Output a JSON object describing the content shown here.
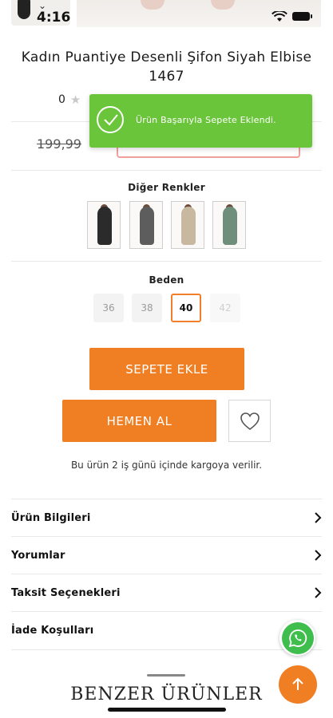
{
  "status_bar": {
    "time": "4:16"
  },
  "product": {
    "title_line1": "Kadın Puantiye Desenli Şifon Siyah Elbise",
    "title_line2": "1467",
    "rating": "0",
    "old_price": "199,99"
  },
  "toast": {
    "message": "Ürün Başarıyla Sepete Eklendi."
  },
  "colors": {
    "label": "Diğer Renkler",
    "variants": [
      {
        "name": "black",
        "color": "#2b2b2b"
      },
      {
        "name": "grey",
        "color": "#5d5d5d"
      },
      {
        "name": "beige",
        "color": "#c9b8a0"
      },
      {
        "name": "green",
        "color": "#6f8f7a"
      }
    ]
  },
  "sizes": {
    "label": "Beden",
    "options": [
      "36",
      "38",
      "40",
      "42"
    ],
    "selected": "40",
    "disabled": [
      "42"
    ]
  },
  "actions": {
    "add_to_cart": "SEPETE EKLE",
    "buy_now": "HEMEN AL",
    "favorite_icon": "heart-icon"
  },
  "shipping_note": "Bu ürün 2 iş günü içinde kargoya verilir.",
  "menu": [
    {
      "label": "Ürün Bilgileri"
    },
    {
      "label": "Yorumlar"
    },
    {
      "label": "Taksit Seçenekleri"
    },
    {
      "label": "İade Koşulları"
    }
  ],
  "floating": {
    "whatsapp_icon": "whatsapp-icon",
    "scroll_top_icon": "arrow-up-icon"
  },
  "similar_section": {
    "title": "BENZER ÜRÜNLER"
  },
  "theme": {
    "accent": "#f07e22",
    "toast": "#6ac53b",
    "whatsapp": "#3fbe4e"
  }
}
